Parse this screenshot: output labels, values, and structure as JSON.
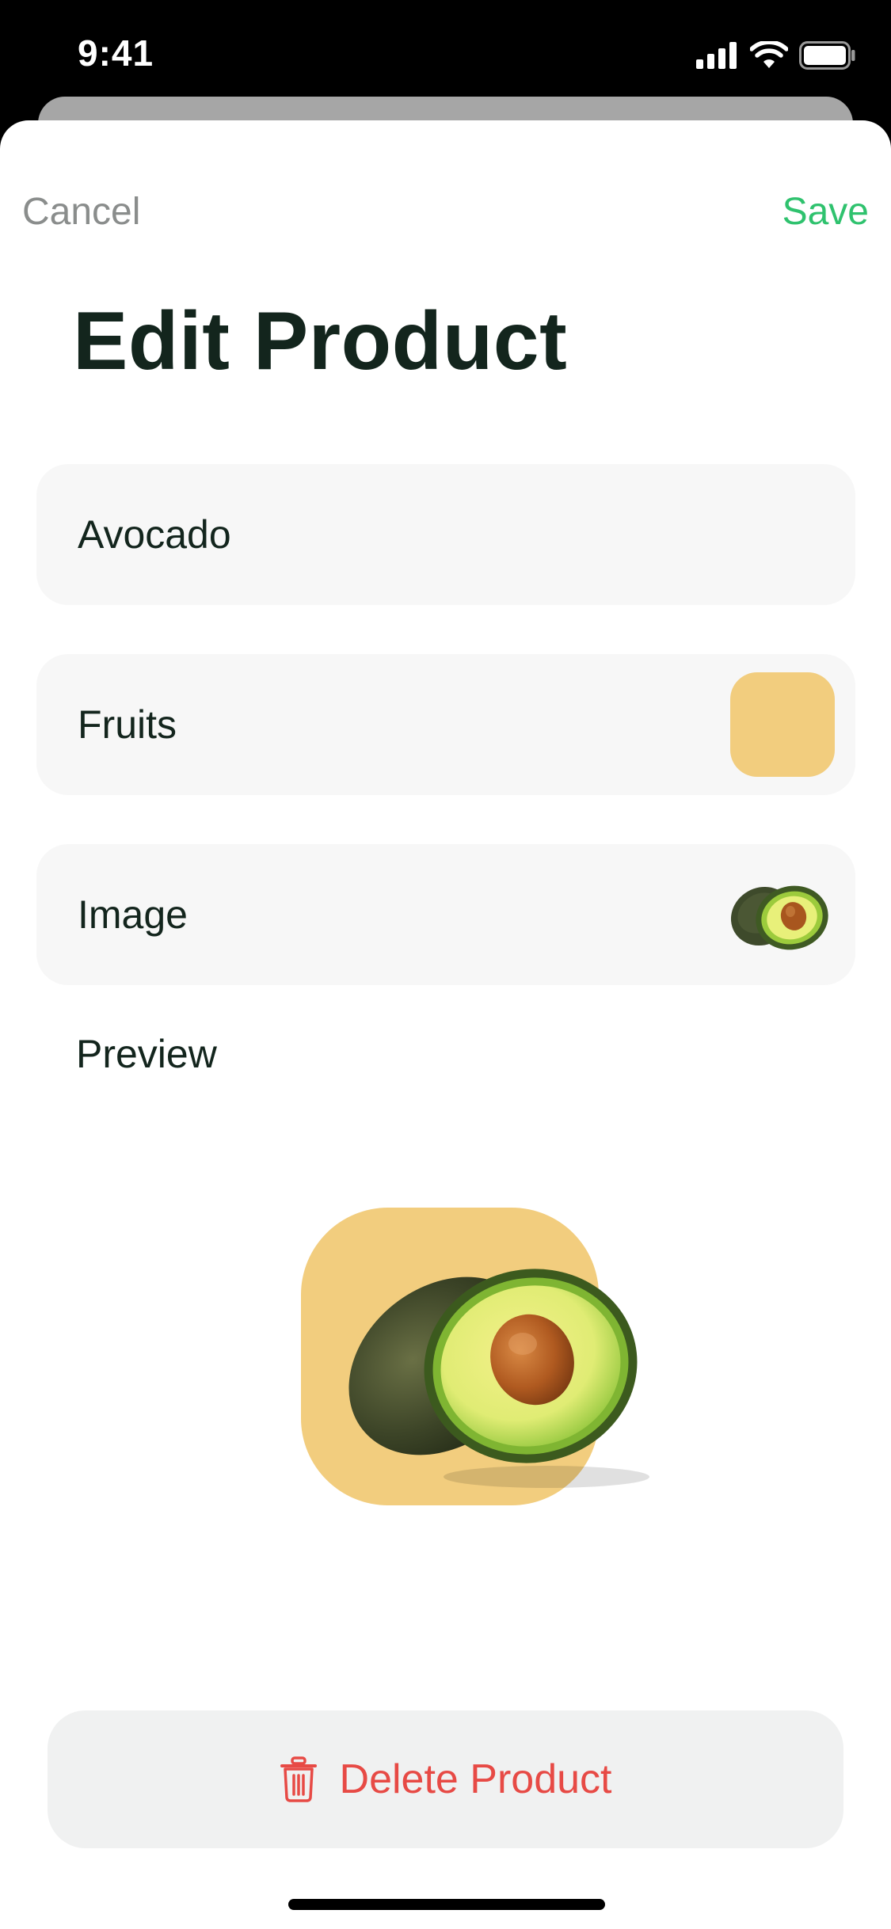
{
  "status_bar": {
    "time": "9:41",
    "icons": [
      "cellular-signal-icon",
      "wifi-icon",
      "battery-icon"
    ]
  },
  "nav": {
    "cancel_label": "Cancel",
    "save_label": "Save"
  },
  "page_title": "Edit Product",
  "fields": {
    "name_value": "Avocado",
    "category_value": "Fruits",
    "category_color": "#f2cd7e",
    "image_label": "Image"
  },
  "preview": {
    "label": "Preview",
    "background_color": "#f2cd7e"
  },
  "delete_button": {
    "label": "Delete Product",
    "icon": "trash-icon"
  },
  "colors": {
    "accent_save": "#2fc26e",
    "destructive": "#e74a45",
    "title_text": "#13251d",
    "field_background": "#f7f7f7"
  }
}
